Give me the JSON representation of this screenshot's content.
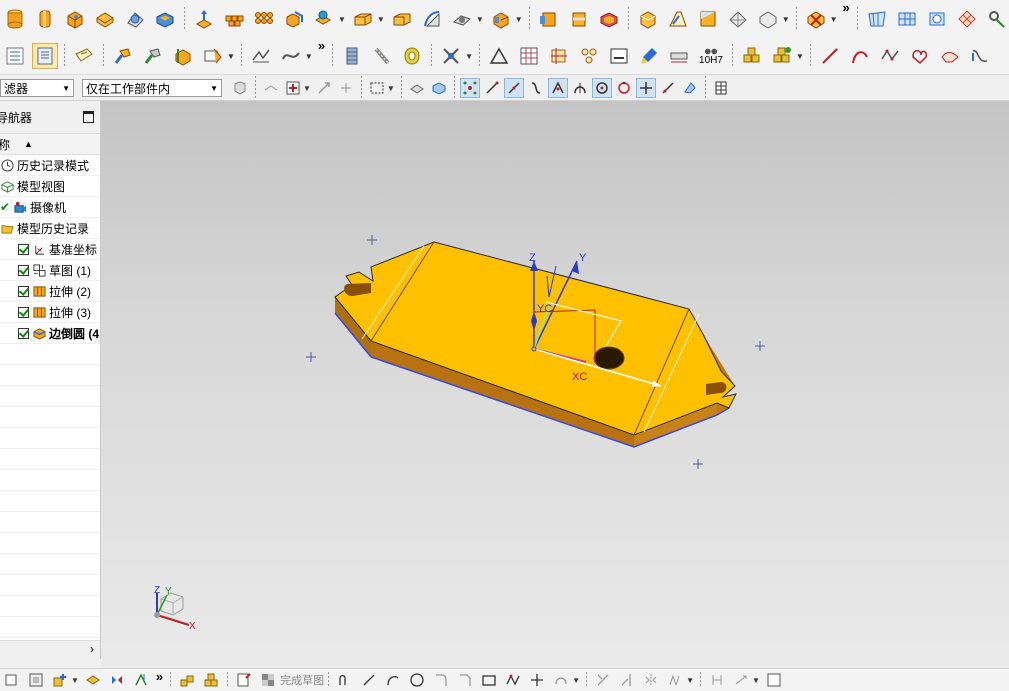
{
  "toolbar_row1": {
    "icons": [
      "cylinder-icon",
      "cylinder-icon",
      "block-icon",
      "block-icon",
      "sphere-icon",
      "block-icon",
      "extrude-icon",
      "pattern-icon",
      "pattern-icon",
      "cube-icon",
      "feature-icon",
      "box-icon",
      "box-icon",
      "curve-icon",
      "surface-icon",
      "cube-icon",
      "cylinder-icon",
      "cylinder-icon",
      "box-icon",
      "surface-icon",
      "box-icon",
      "sphere-icon",
      "sphere-icon",
      "surface-icon",
      "mesh-icon",
      "swept-icon",
      "surface-icon",
      "gear-icon"
    ]
  },
  "toolbar_row2": {
    "icons": [
      "list-icon",
      "doc-icon",
      "tag-icon",
      "hammer-icon",
      "feature-icon",
      "feature-icon",
      "measure-icon",
      "curve-icon",
      "spring-icon",
      "coil-icon",
      "puller-icon",
      "triangle-icon",
      "grid-icon",
      "sketch-icon",
      "molecule-icon",
      "note-icon",
      "brush-icon",
      "tolerance-icon",
      "box-icon",
      "box-icon",
      "line-icon",
      "arc-icon",
      "polyline-icon",
      "shape-icon",
      "surface-icon",
      "curve-icon"
    ],
    "tolerance_label": "10H7"
  },
  "selection_bar": {
    "type_filter": "滤器",
    "scope_filter": "仅在工作部件内"
  },
  "navigator": {
    "title": "导航器",
    "column_name": "称",
    "sort_arrow": "▲",
    "items": [
      {
        "label": "历史记录模式",
        "icon": "clock-icon",
        "level": 0,
        "checked": false
      },
      {
        "label": "模型视图",
        "icon": "model-view-icon",
        "level": 0,
        "checked": false
      },
      {
        "label": "摄像机",
        "icon": "camera-icon",
        "level": 0,
        "checked": true
      },
      {
        "label": "模型历史记录",
        "icon": "folder-icon",
        "level": 0,
        "checked": false
      },
      {
        "label": "基准坐标",
        "icon": "datum-csys-icon",
        "level": 1,
        "checked": true
      },
      {
        "label": "草图 (1)",
        "icon": "sketch-icon",
        "level": 1,
        "checked": true
      },
      {
        "label": "拉伸 (2)",
        "icon": "extrude-icon",
        "level": 1,
        "checked": true
      },
      {
        "label": "拉伸 (3)",
        "icon": "extrude-icon",
        "level": 1,
        "checked": true
      },
      {
        "label": "边倒圆 (4",
        "icon": "edge-blend-icon",
        "level": 1,
        "checked": true,
        "bold": true
      }
    ]
  },
  "viewport": {
    "part_color": "#FFC000",
    "part_side_color": "#C07A10",
    "background_top": "#c4c4c4",
    "background_bottom": "#eaeaea",
    "axis_labels": {
      "z": "Z",
      "y": "Y",
      "yc": "YC",
      "xc": "XC"
    },
    "triad_labels": {
      "z": "Z",
      "y": "Y",
      "x": "X"
    }
  },
  "bottom_toolbar": {
    "finish_sketch_label": "完成草图",
    "icons": [
      "sketch-icon",
      "box-icon",
      "add-icon",
      "part-icon",
      "mirror-icon",
      "constraint-icon",
      "assembly-icon",
      "assembly-icon",
      "sketch-icon",
      "finish-flag-icon",
      "profile-icon",
      "line-icon",
      "arc-icon",
      "circle-icon",
      "fillet-icon",
      "chamfer-icon",
      "rectangle-icon",
      "polygon-icon",
      "point-icon",
      "offset-icon",
      "trim-icon",
      "extend-icon",
      "mirror-icon",
      "pattern-icon",
      "constraint-icon",
      "dimension-icon",
      "window-icon"
    ]
  }
}
